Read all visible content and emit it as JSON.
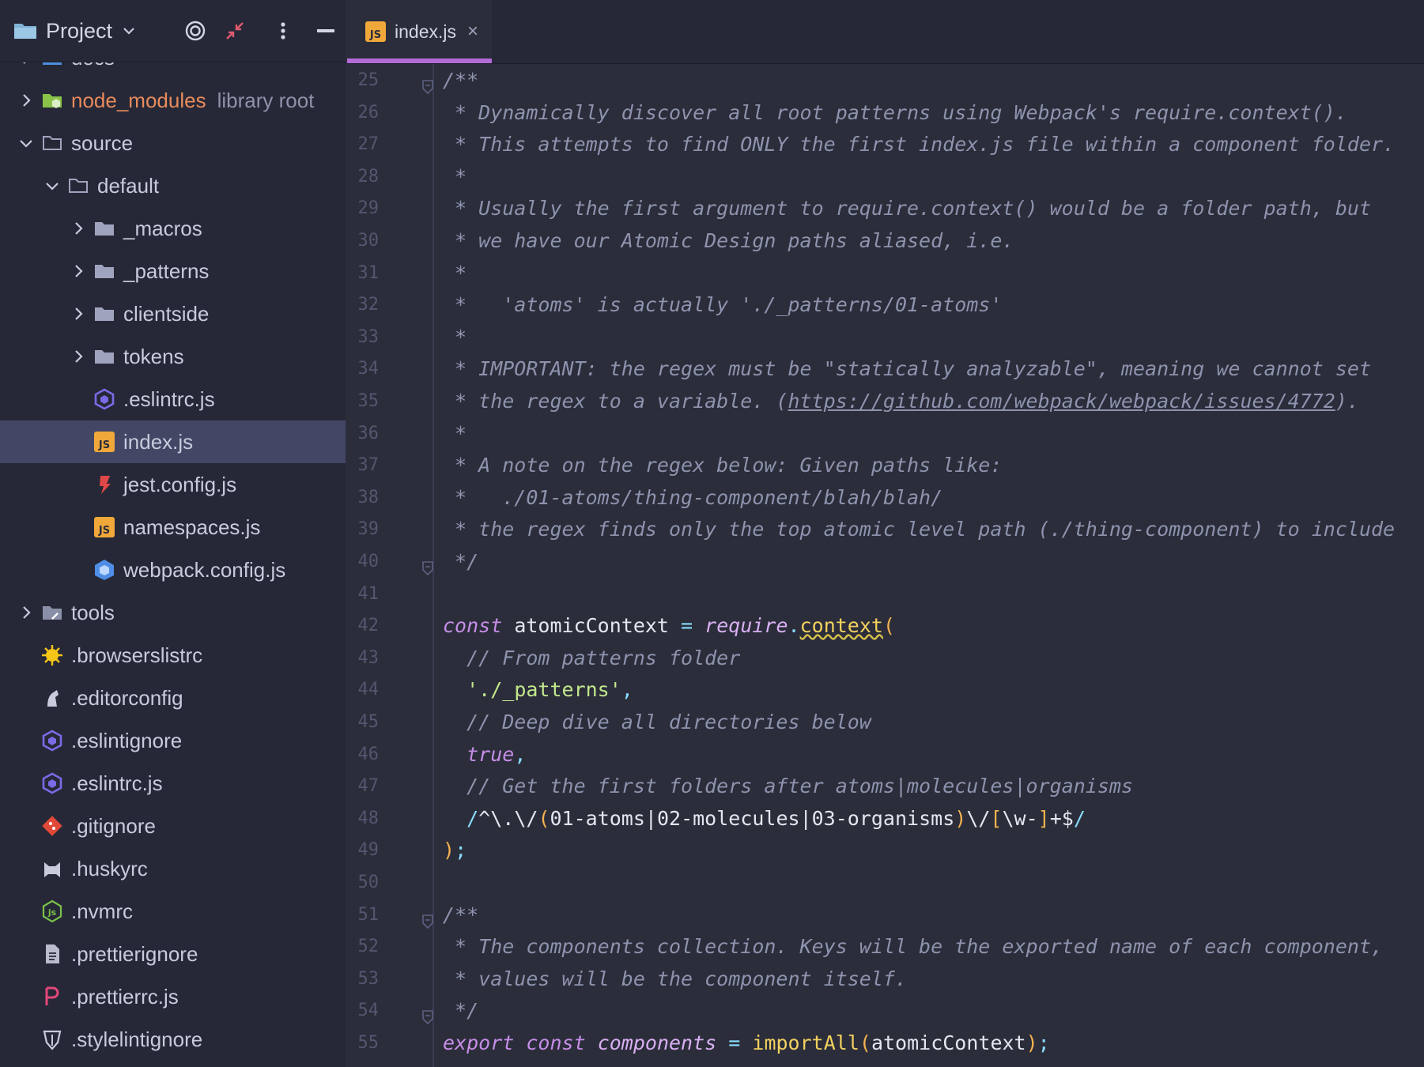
{
  "project_toolbar": {
    "title": "Project"
  },
  "tree": [
    {
      "label": "docs",
      "indent": 1,
      "arrow": "right",
      "icon": "folder-blue-icon"
    },
    {
      "label": "node_modules",
      "note": "library root",
      "indent": 1,
      "arrow": "right",
      "icon": "node-folder-icon",
      "style": "orange"
    },
    {
      "label": "source",
      "indent": 1,
      "arrow": "down",
      "icon": "folder-open-icon"
    },
    {
      "label": "default",
      "indent": 2,
      "arrow": "down",
      "icon": "folder-open-icon"
    },
    {
      "label": "_macros",
      "indent": 3,
      "arrow": "right",
      "icon": "folder-icon"
    },
    {
      "label": "_patterns",
      "indent": 3,
      "arrow": "right",
      "icon": "folder-icon"
    },
    {
      "label": "clientside",
      "indent": 3,
      "arrow": "right",
      "icon": "folder-icon"
    },
    {
      "label": "tokens",
      "indent": 3,
      "arrow": "right",
      "icon": "folder-icon"
    },
    {
      "label": ".eslintrc.js",
      "indent": 3,
      "arrow": "none",
      "icon": "eslint-icon"
    },
    {
      "label": "index.js",
      "indent": 3,
      "arrow": "none",
      "icon": "js-file-icon",
      "selected": true
    },
    {
      "label": "jest.config.js",
      "indent": 3,
      "arrow": "none",
      "icon": "jest-icon"
    },
    {
      "label": "namespaces.js",
      "indent": 3,
      "arrow": "none",
      "icon": "js-file-icon"
    },
    {
      "label": "webpack.config.js",
      "indent": 3,
      "arrow": "none",
      "icon": "webpack-icon"
    },
    {
      "label": "tools",
      "indent": 1,
      "arrow": "right",
      "icon": "tools-folder-icon"
    },
    {
      "label": ".browserslistrc",
      "indent": 1,
      "arrow": "none",
      "icon": "browserslist-icon"
    },
    {
      "label": ".editorconfig",
      "indent": 1,
      "arrow": "none",
      "icon": "editorconfig-icon"
    },
    {
      "label": ".eslintignore",
      "indent": 1,
      "arrow": "none",
      "icon": "eslint-icon"
    },
    {
      "label": ".eslintrc.js",
      "indent": 1,
      "arrow": "none",
      "icon": "eslint-icon"
    },
    {
      "label": ".gitignore",
      "indent": 1,
      "arrow": "none",
      "icon": "git-icon"
    },
    {
      "label": ".huskyrc",
      "indent": 1,
      "arrow": "none",
      "icon": "husky-icon"
    },
    {
      "label": ".nvmrc",
      "indent": 1,
      "arrow": "none",
      "icon": "nodejs-icon"
    },
    {
      "label": ".prettierignore",
      "indent": 1,
      "arrow": "none",
      "icon": "text-file-icon"
    },
    {
      "label": ".prettierrc.js",
      "indent": 1,
      "arrow": "none",
      "icon": "prettier-icon"
    },
    {
      "label": ".stylelintignore",
      "indent": 1,
      "arrow": "none",
      "icon": "stylelint-icon"
    }
  ],
  "editor_tab": {
    "label": "index.js",
    "close_glyph": "×"
  },
  "code_lines": [
    {
      "n": "25",
      "fold": true,
      "t": [
        [
          "cm",
          "/**"
        ]
      ]
    },
    {
      "n": "26",
      "t": [
        [
          "cm",
          " * Dynamically discover all root patterns using Webpack's require.context()."
        ]
      ]
    },
    {
      "n": "27",
      "t": [
        [
          "cm",
          " * This attempts to find ONLY the first index.js file within a component folder."
        ]
      ]
    },
    {
      "n": "28",
      "t": [
        [
          "cm",
          " *"
        ]
      ]
    },
    {
      "n": "29",
      "t": [
        [
          "cm",
          " * Usually the first argument to require.context() would be a folder path, but"
        ]
      ]
    },
    {
      "n": "30",
      "t": [
        [
          "cm",
          " * we have our Atomic Design paths aliased, i.e."
        ]
      ]
    },
    {
      "n": "31",
      "t": [
        [
          "cm",
          " *"
        ]
      ]
    },
    {
      "n": "32",
      "t": [
        [
          "cm",
          " *   'atoms' is actually './_patterns/01-atoms'"
        ]
      ]
    },
    {
      "n": "33",
      "t": [
        [
          "cm",
          " *"
        ]
      ]
    },
    {
      "n": "34",
      "t": [
        [
          "cm",
          " * IMPORTANT: the regex must be \"statically analyzable\", meaning we cannot set"
        ]
      ]
    },
    {
      "n": "35",
      "t": [
        [
          "cm",
          " * the regex to a variable. ("
        ],
        [
          "cm url",
          "https://github.com/webpack/webpack/issues/4772"
        ],
        [
          "cm",
          ")."
        ]
      ]
    },
    {
      "n": "36",
      "t": [
        [
          "cm",
          " *"
        ]
      ]
    },
    {
      "n": "37",
      "t": [
        [
          "cm",
          " * A note on the regex below: Given paths like:"
        ]
      ]
    },
    {
      "n": "38",
      "t": [
        [
          "cm",
          " *   ./01-atoms/thing-component/blah/blah/"
        ]
      ]
    },
    {
      "n": "39",
      "t": [
        [
          "cm",
          " * the regex finds only the top atomic level path (./thing-component) to include"
        ]
      ]
    },
    {
      "n": "40",
      "fold": true,
      "t": [
        [
          "cm",
          " */"
        ]
      ]
    },
    {
      "n": "41",
      "t": []
    },
    {
      "n": "42",
      "t": [
        [
          "kw",
          "const"
        ],
        [
          "id",
          " atomicContext "
        ],
        [
          "op",
          "="
        ],
        [
          "id",
          " "
        ],
        [
          "it",
          "require"
        ],
        [
          "op",
          "."
        ],
        [
          "fn squig",
          "context"
        ],
        [
          "pn",
          "("
        ]
      ]
    },
    {
      "n": "43",
      "t": [
        [
          "cm",
          "  // From patterns folder"
        ]
      ]
    },
    {
      "n": "44",
      "t": [
        [
          "id",
          "  "
        ],
        [
          "str",
          "'./_patterns'"
        ],
        [
          "op",
          ","
        ]
      ]
    },
    {
      "n": "45",
      "t": [
        [
          "cm",
          "  // Deep dive all directories below"
        ]
      ]
    },
    {
      "n": "46",
      "t": [
        [
          "id",
          "  "
        ],
        [
          "bool",
          "true"
        ],
        [
          "op",
          ","
        ]
      ]
    },
    {
      "n": "47",
      "t": [
        [
          "cm",
          "  // Get the first folders after atoms|molecules|organisms"
        ]
      ]
    },
    {
      "n": "48",
      "t": [
        [
          "id",
          "  "
        ],
        [
          "op",
          "/"
        ],
        [
          "id",
          "^\\.\\/"
        ],
        [
          "pn",
          "("
        ],
        [
          "id",
          "01-atoms|02-molecules|03-organisms"
        ],
        [
          "pn",
          ")"
        ],
        [
          "id",
          "\\/"
        ],
        [
          "pn",
          "["
        ],
        [
          "id",
          "\\w-"
        ],
        [
          "pn",
          "]"
        ],
        [
          "id",
          "+$"
        ],
        [
          "op",
          "/"
        ]
      ]
    },
    {
      "n": "49",
      "t": [
        [
          "pn",
          ")"
        ],
        [
          "op",
          ";"
        ]
      ]
    },
    {
      "n": "50",
      "t": []
    },
    {
      "n": "51",
      "fold": true,
      "t": [
        [
          "cm",
          "/**"
        ]
      ]
    },
    {
      "n": "52",
      "t": [
        [
          "cm",
          " * The components collection. Keys will be the exported name of each component,"
        ]
      ]
    },
    {
      "n": "53",
      "t": [
        [
          "cm",
          " * values will be the component itself."
        ]
      ]
    },
    {
      "n": "54",
      "fold": true,
      "t": [
        [
          "cm",
          " */"
        ]
      ]
    },
    {
      "n": "55",
      "t": [
        [
          "kw",
          "export"
        ],
        [
          "id",
          " "
        ],
        [
          "kw",
          "const"
        ],
        [
          "id",
          " "
        ],
        [
          "it",
          "components"
        ],
        [
          "id",
          " "
        ],
        [
          "op",
          "="
        ],
        [
          "id",
          " "
        ],
        [
          "fn",
          "importAll"
        ],
        [
          "pn",
          "("
        ],
        [
          "id",
          "atomicContext"
        ],
        [
          "pn",
          ")"
        ],
        [
          "op",
          ";"
        ]
      ]
    }
  ]
}
